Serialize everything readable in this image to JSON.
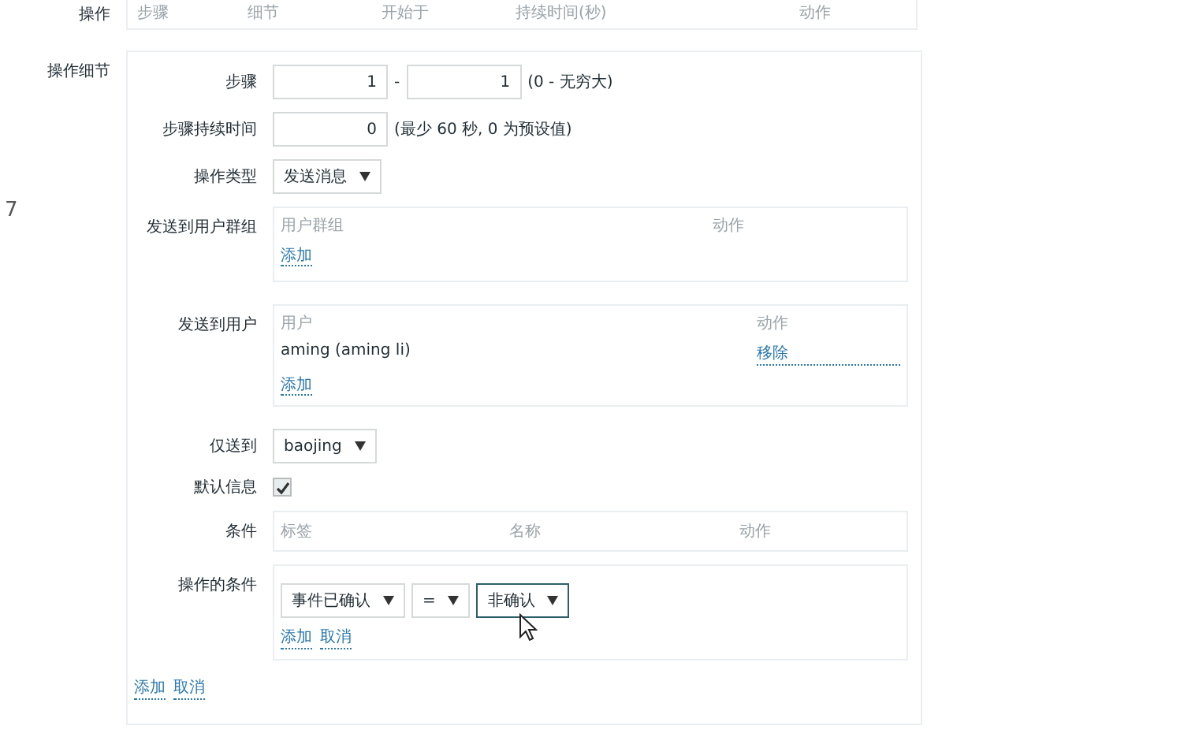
{
  "operations": {
    "label": "操作",
    "columns": [
      "步骤",
      "细节",
      "开始于",
      "持续时间(秒)",
      "动作"
    ]
  },
  "side_marker": "7",
  "operation_details": {
    "label": "操作细节",
    "steps": {
      "label": "步骤",
      "from": "1",
      "separator": "-",
      "to": "1",
      "hint": "(0 - 无穷大)"
    },
    "step_duration": {
      "label": "步骤持续时间",
      "value": "0",
      "hint": "(最少 60 秒, 0 为预设值)"
    },
    "operation_type": {
      "label": "操作类型",
      "value": "发送消息"
    },
    "send_to_user_groups": {
      "label": "发送到用户群组",
      "columns": [
        "用户群组",
        "动作"
      ],
      "add_link": "添加"
    },
    "send_to_users": {
      "label": "发送到用户",
      "columns": [
        "用户",
        "动作"
      ],
      "rows": [
        {
          "name": "aming (aming li)",
          "action": "移除"
        }
      ],
      "add_link": "添加"
    },
    "send_only_to": {
      "label": "仅送到",
      "value": "baojing"
    },
    "default_message": {
      "label": "默认信息",
      "checked": true
    },
    "conditions": {
      "label": "条件",
      "columns": [
        "标签",
        "名称",
        "动作"
      ]
    },
    "operation_condition": {
      "label": "操作的条件",
      "selects": [
        {
          "value": "事件已确认",
          "focused": false
        },
        {
          "value": "=",
          "focused": false
        },
        {
          "value": "非确认",
          "focused": true
        }
      ],
      "links": [
        "添加",
        "取消"
      ]
    },
    "links": [
      "添加",
      "取消"
    ]
  }
}
